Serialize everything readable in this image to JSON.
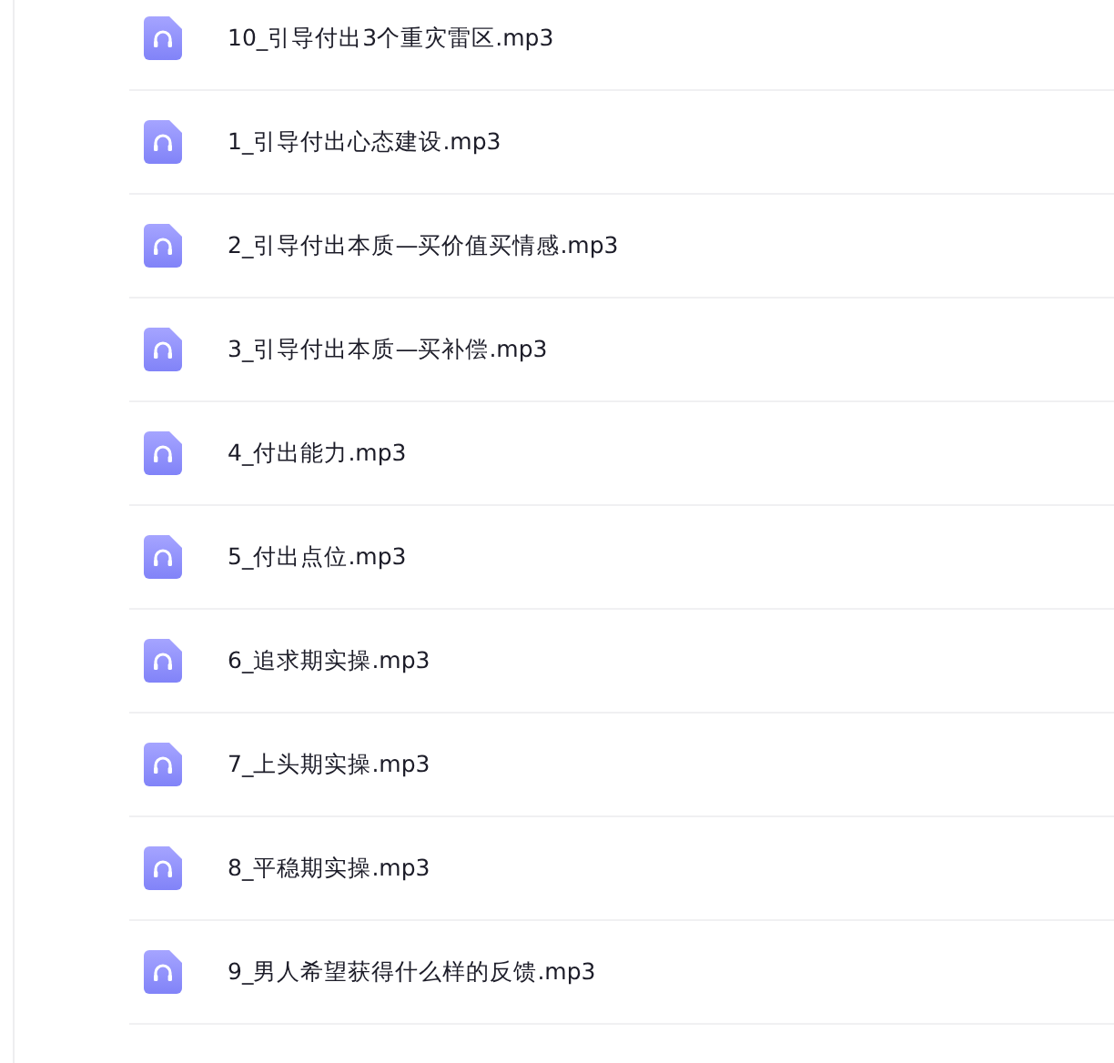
{
  "files": [
    {
      "name": "10_引导付出3个重灾雷区.mp3"
    },
    {
      "name": "1_引导付出心态建设.mp3"
    },
    {
      "name": "2_引导付出本质—买价值买情感.mp3"
    },
    {
      "name": "3_引导付出本质—买补偿.mp3"
    },
    {
      "name": "4_付出能力.mp3"
    },
    {
      "name": "5_付出点位.mp3"
    },
    {
      "name": "6_追求期实操.mp3"
    },
    {
      "name": "7_上头期实操.mp3"
    },
    {
      "name": "8_平稳期实操.mp3"
    },
    {
      "name": "9_男人希望获得什么样的反馈.mp3"
    }
  ]
}
